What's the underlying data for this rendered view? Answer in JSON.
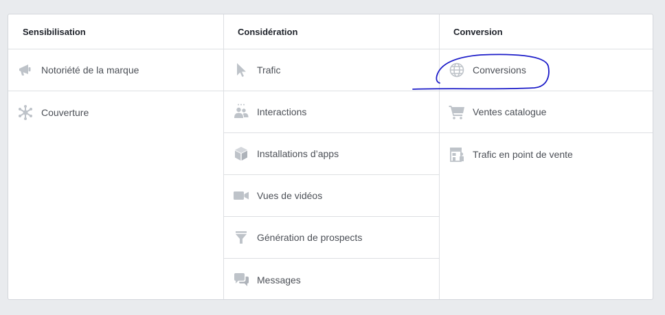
{
  "columns": [
    {
      "title": "Sensibilisation",
      "items": [
        {
          "label": "Notoriété de la marque",
          "icon": "megaphone-icon"
        },
        {
          "label": "Couverture",
          "icon": "reach-icon"
        }
      ]
    },
    {
      "title": "Considération",
      "items": [
        {
          "label": "Trafic",
          "icon": "cursor-icon"
        },
        {
          "label": "Interactions",
          "icon": "people-icon"
        },
        {
          "label": "Installations d’apps",
          "icon": "box-icon"
        },
        {
          "label": "Vues de vidéos",
          "icon": "video-camera-icon"
        },
        {
          "label": "Génération de prospects",
          "icon": "funnel-icon"
        },
        {
          "label": "Messages",
          "icon": "chat-bubbles-icon"
        }
      ]
    },
    {
      "title": "Conversion",
      "items": [
        {
          "label": "Conversions",
          "icon": "globe-icon"
        },
        {
          "label": "Ventes catalogue",
          "icon": "shopping-cart-icon"
        },
        {
          "label": "Trafic en point de vente",
          "icon": "store-icon"
        }
      ]
    }
  ],
  "colors": {
    "icon": "#bec3c9",
    "text": "#4b4f56",
    "header": "#1d2129",
    "annotation": "#1a1ac8"
  }
}
